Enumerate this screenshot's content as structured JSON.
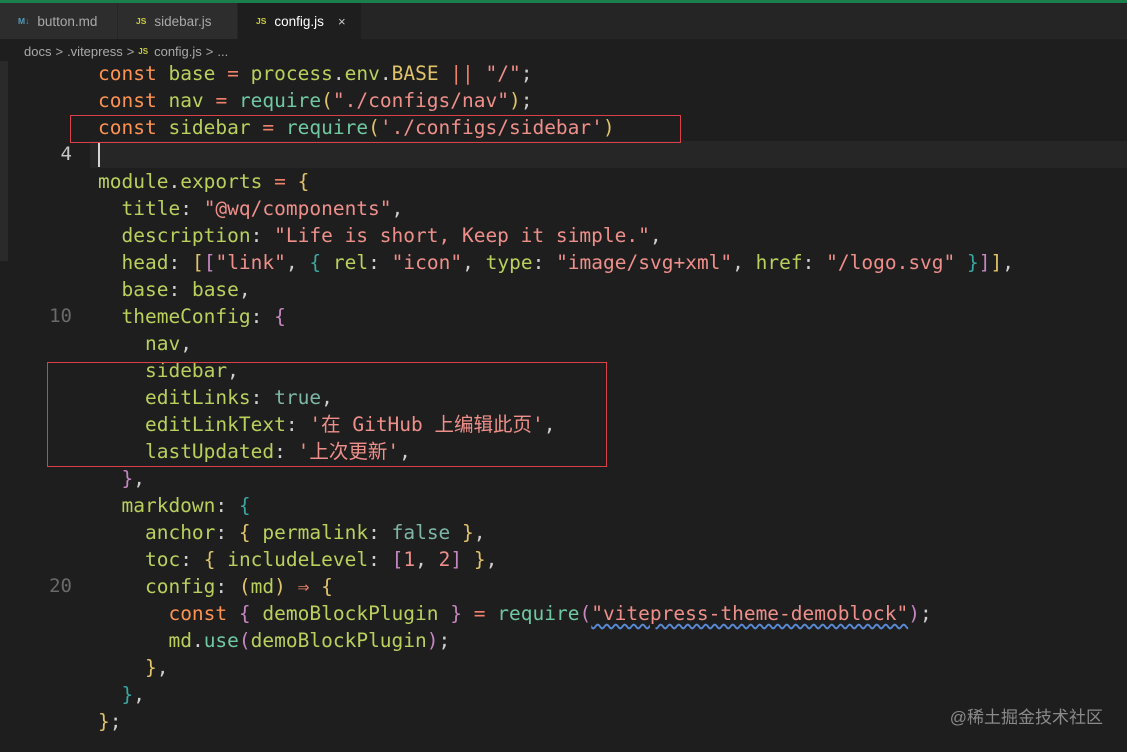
{
  "tabs": [
    {
      "icon": "M↓",
      "label": "button.md",
      "active": false
    },
    {
      "icon": "JS",
      "label": "sidebar.js",
      "active": false
    },
    {
      "icon": "JS",
      "label": "config.js",
      "active": true
    }
  ],
  "close_glyph": "×",
  "breadcrumb": {
    "items": [
      "docs",
      ".vitepress",
      "config.js",
      "..."
    ],
    "separator": ">",
    "file_icon": "JS"
  },
  "line_numbers": {
    "current": "4",
    "ten": "10",
    "twenty": "20"
  },
  "watermark": "@稀土掘金技术社区",
  "colors": {
    "accent_top": "#1b7f4d",
    "highlight_box": "#d9404a",
    "keyword": "#fd9353",
    "string": "#ee8f8a"
  },
  "code_lines": [
    "const base = process.env.BASE || \"/\";",
    "const nav = require(\"./configs/nav\");",
    "const sidebar = require('./configs/sidebar')",
    "",
    "module.exports = {",
    "  title: \"@wq/components\",",
    "  description: \"Life is short, Keep it simple.\",",
    "  head: [[\"link\", { rel: \"icon\", type: \"image/svg+xml\", href: \"/logo.svg\" }]],",
    "  base: base,",
    "  themeConfig: {",
    "    nav,",
    "    sidebar,",
    "    editLinks: true,",
    "    editLinkText: '在 GitHub 上编辑此页',",
    "    lastUpdated: '上次更新',",
    "  },",
    "  markdown: {",
    "    anchor: { permalink: false },",
    "    toc: { includeLevel: [1, 2] },",
    "    config: (md) => {",
    "      const { demoBlockPlugin } = require(\"vitepress-theme-demoblock\");",
    "      md.use(demoBlockPlugin);",
    "    },",
    "  },",
    "};"
  ]
}
